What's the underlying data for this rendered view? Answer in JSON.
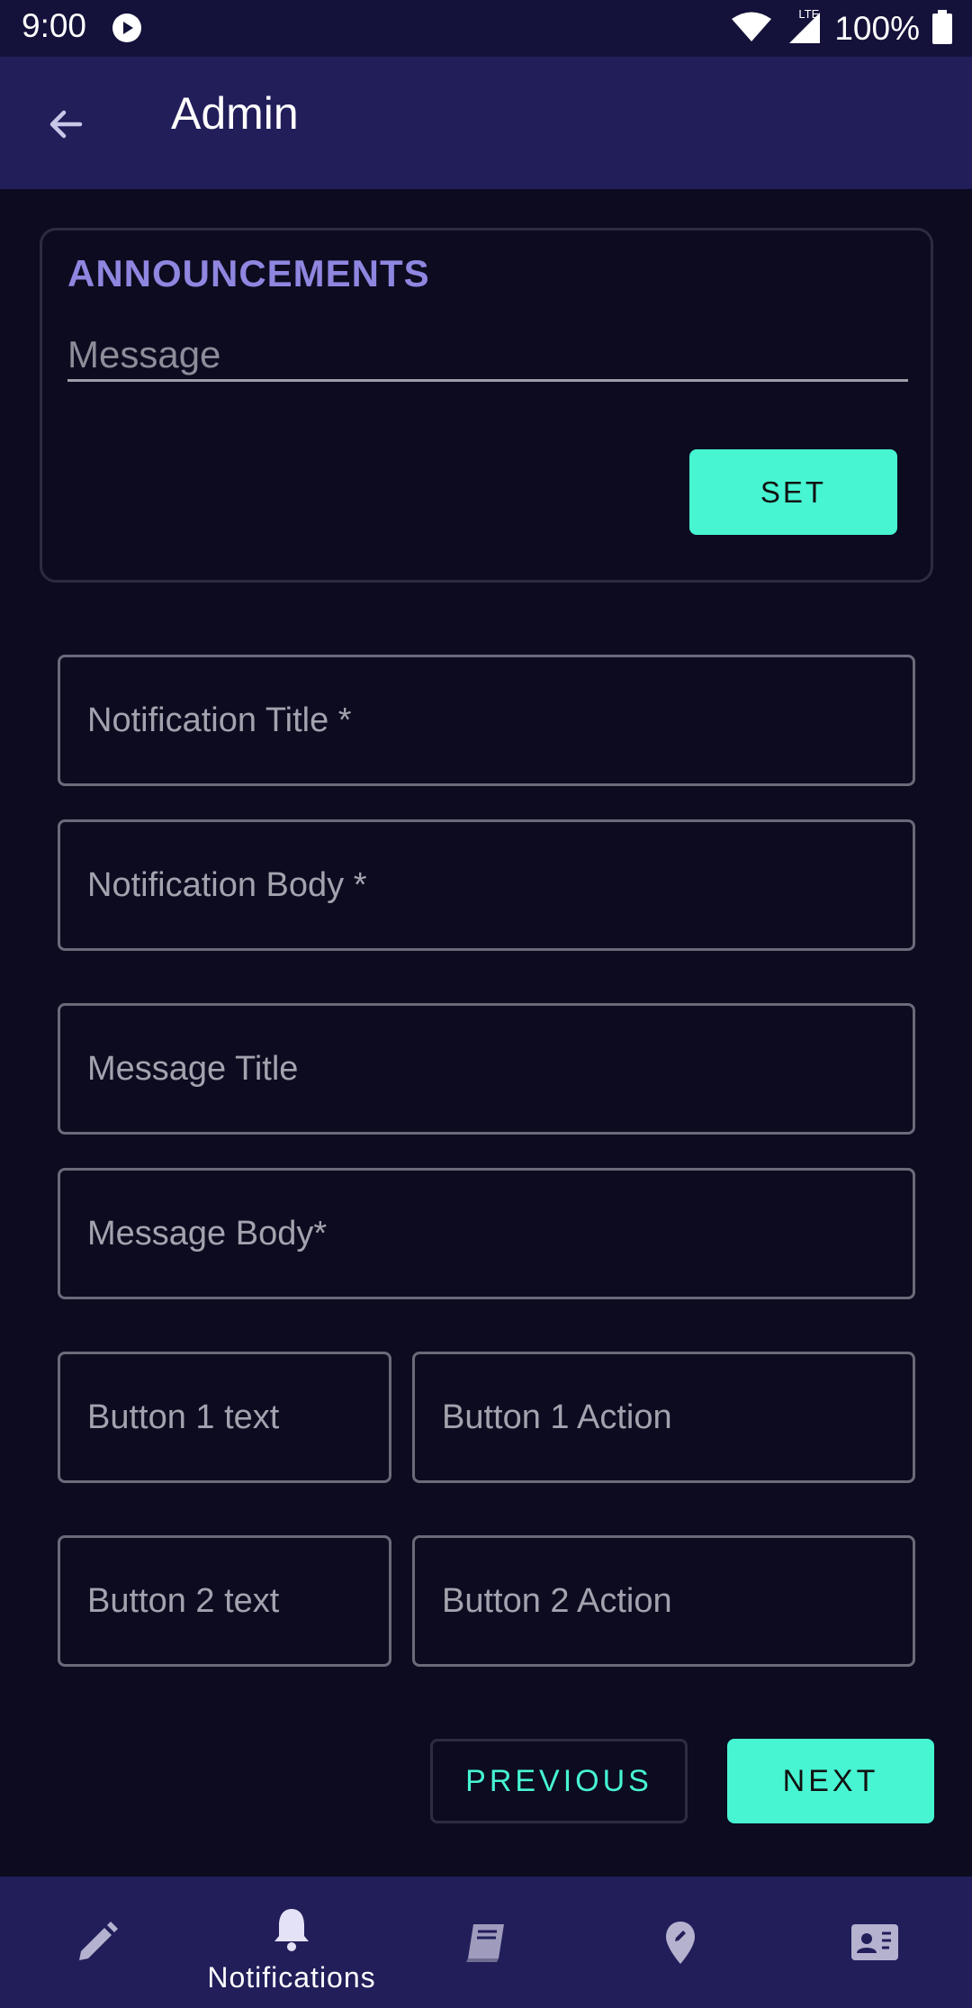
{
  "status_bar": {
    "time": "9:00",
    "network": "LTE",
    "battery": "100%",
    "icons": [
      "play-icon",
      "wifi-icon",
      "signal-icon",
      "battery-icon"
    ]
  },
  "app_bar": {
    "title": "Admin",
    "back_icon": "arrow-left-icon"
  },
  "announcements": {
    "heading": "ANNOUNCEMENTS",
    "message_placeholder": "Message",
    "message_value": "",
    "set_label": "SET"
  },
  "form": {
    "notification_title_placeholder": "Notification Title *",
    "notification_body_placeholder": "Notification Body *",
    "message_title_placeholder": "Message Title",
    "message_body_placeholder": "Message Body*",
    "button1_text_placeholder": "Button 1 text",
    "button1_action_placeholder": "Button 1 Action",
    "button2_text_placeholder": "Button 2 text",
    "button2_action_placeholder": "Button 2 Action"
  },
  "actions": {
    "previous_label": "PREVIOUS",
    "next_label": "NEXT"
  },
  "bottom_nav": {
    "items": [
      {
        "icon": "pencil-icon",
        "label": ""
      },
      {
        "icon": "bell-icon",
        "label": "Notifications"
      },
      {
        "icon": "book-icon",
        "label": ""
      },
      {
        "icon": "map-pin-icon",
        "label": ""
      },
      {
        "icon": "contact-card-icon",
        "label": ""
      }
    ],
    "active_index": 1
  },
  "colors": {
    "background": "#0c0b20",
    "app_bar": "#221e5a",
    "accent": "#47f5d3",
    "heading": "#8f86e0"
  }
}
